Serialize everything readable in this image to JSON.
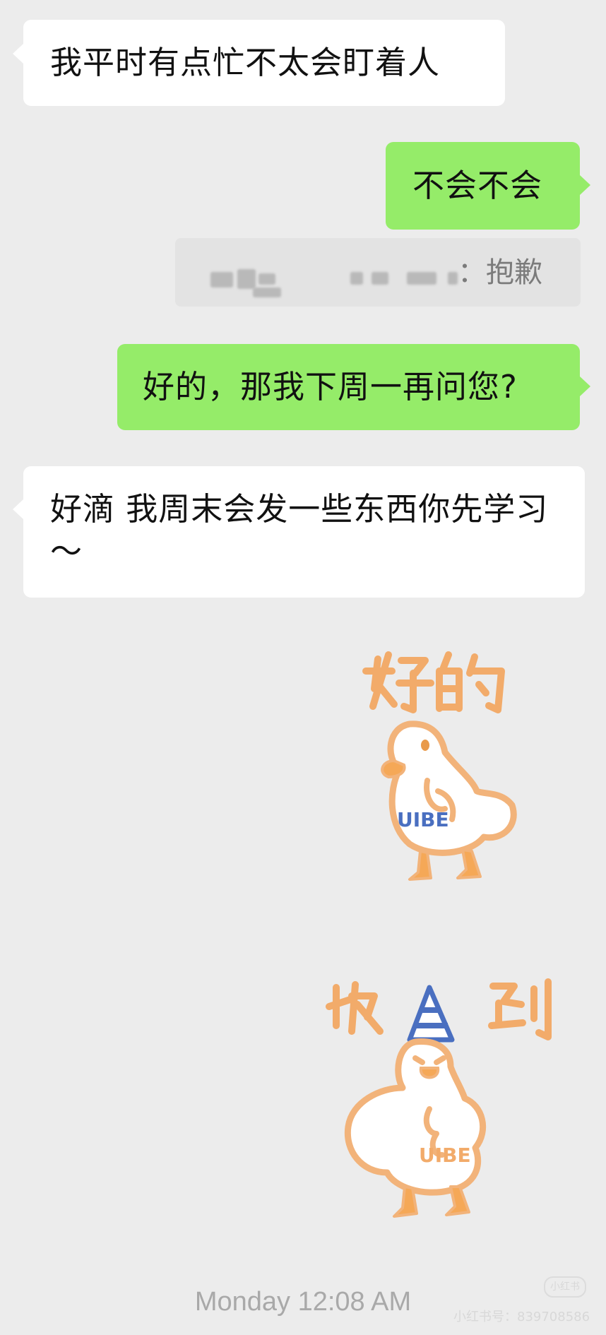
{
  "messages": [
    {
      "id": "m1",
      "side": "incoming",
      "text": "我平时有点忙不太会盯着人"
    },
    {
      "id": "m2",
      "side": "outgoing",
      "text": "不会不会"
    },
    {
      "id": "m3",
      "side": "quote",
      "text": "：抱歉"
    },
    {
      "id": "m4",
      "side": "outgoing",
      "text": "好的，那我下周一再问您?"
    },
    {
      "id": "m5",
      "side": "incoming",
      "text": "好滴 我周末会发一些东西你先学习～"
    }
  ],
  "stickers": [
    {
      "id": "s1",
      "caption": "好的",
      "brand": "UIBE"
    },
    {
      "id": "s2",
      "caption": "收到",
      "brand": "UIBE"
    }
  ],
  "timestamp": "Monday 12:08 AM",
  "watermark": {
    "logo": "小红书",
    "id_text": "小红书号：839708586"
  },
  "colors": {
    "background": "#ececec",
    "incoming_bubble": "#ffffff",
    "outgoing_bubble": "#95ec69",
    "sticker_orange": "#f2ab6a",
    "sticker_blue": "#4a6fc0"
  }
}
